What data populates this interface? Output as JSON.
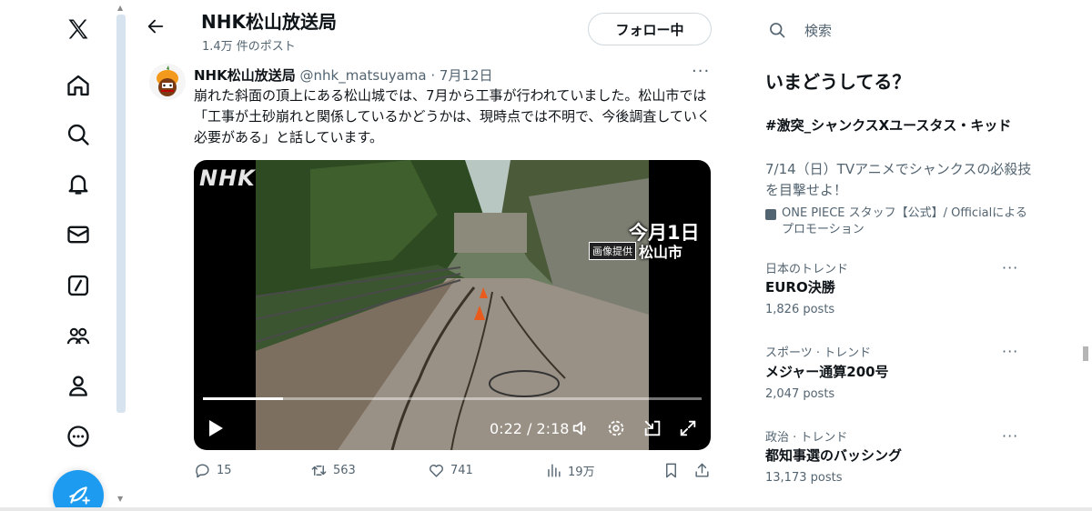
{
  "header": {
    "title": "NHK松山放送局",
    "post_count": "1.4万 件のポスト",
    "follow_label": "フォロー中"
  },
  "tweet": {
    "name": "NHK松山放送局",
    "handle": "@nhk_matsuyama",
    "date": "· 7月12日",
    "text": "崩れた斜面の頂上にある松山城では、7月から工事が行われていました。松山市では「工事が土砂崩れと関係しているかどうかは、現時点では不明で、今後調査していく必要がある」と話しています。",
    "video": {
      "logo": "NHK",
      "caption_date": "今月1日",
      "caption_source_label": "画像提供",
      "caption_source": "松山市",
      "time": "0:22 / 2:18",
      "progress": 0.16
    },
    "actions": {
      "replies": "15",
      "reposts": "563",
      "likes": "741",
      "views": "19万"
    }
  },
  "sidebar": {
    "search_placeholder": "検索",
    "trends_title": "いまどうしてる？",
    "promoted": {
      "headline": "#激突_シャンクスXユースタス・キッド",
      "description": "7/14（日）TVアニメでシャンクスの必殺技を目撃せよ！",
      "promoter": "ONE PIECE スタッフ【公式】/ Officialによるプロモーション"
    },
    "trends": [
      {
        "category": "日本のトレンド",
        "name": "EURO決勝",
        "posts": "1,826 posts"
      },
      {
        "category": "スポーツ · トレンド",
        "name": "メジャー通算200号",
        "posts": "2,047 posts"
      },
      {
        "category": "政治 · トレンド",
        "name": "都知事選のバッシング",
        "posts": "13,173 posts"
      }
    ]
  },
  "colors": {
    "accent": "#1d9bf0",
    "text_primary": "#0f1419",
    "text_secondary": "#536471"
  },
  "icons": [
    "x-logo-icon",
    "home-icon",
    "search-icon",
    "bell-icon",
    "mail-icon",
    "grok-icon",
    "communities-icon",
    "profile-icon",
    "more-icon",
    "compose-icon"
  ]
}
